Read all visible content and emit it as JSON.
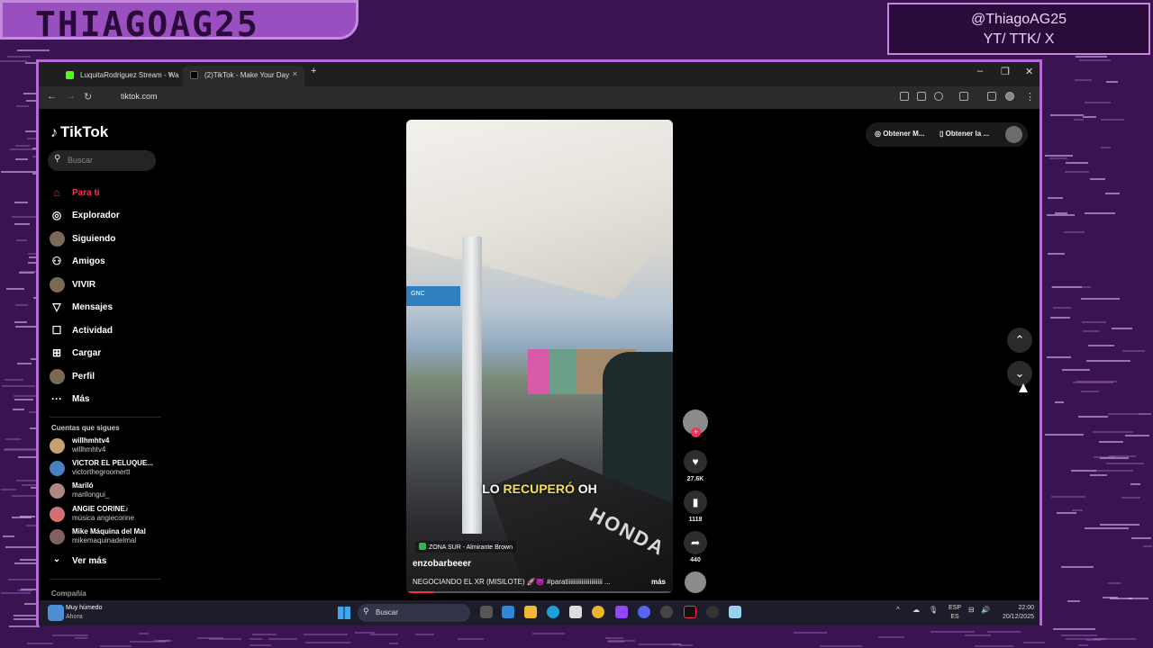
{
  "overlay": {
    "banner": "THIAGOAG25",
    "social_handle": "@ThiagoAG25",
    "social_platforms": "YT/ TTK/ X"
  },
  "browser": {
    "tabs": [
      {
        "label": "LuquitaRodriguez Stream - Wa",
        "close": "×",
        "favicon_color": "#53fc18"
      },
      {
        "label": "(2)TikTok - Make Your Day",
        "close": "×",
        "favicon_color": "#000000"
      }
    ],
    "new_tab": "+",
    "window_controls": {
      "minimize": "–",
      "restore": "❐",
      "close": "✕"
    },
    "nav": {
      "back": "←",
      "forward": "→",
      "reload": "↻"
    },
    "url": "tiktok.com"
  },
  "tiktok": {
    "logo": "TikTok",
    "logo_icon": "♪",
    "search_placeholder": "Buscar",
    "nav": [
      {
        "label": "Para ti",
        "icon": "home-icon",
        "glyph": "⌂",
        "active": true
      },
      {
        "label": "Explorador",
        "icon": "compass-icon",
        "glyph": "◎"
      },
      {
        "label": "Siguiendo",
        "icon": "following-avatar",
        "glyph": ""
      },
      {
        "label": "Amigos",
        "icon": "friends-icon",
        "glyph": "⚇"
      },
      {
        "label": "VIVIR",
        "icon": "live-avatar",
        "glyph": ""
      },
      {
        "label": "Mensajes",
        "icon": "send-icon",
        "glyph": "▽"
      },
      {
        "label": "Actividad",
        "icon": "inbox-icon",
        "glyph": "☐"
      },
      {
        "label": "Cargar",
        "icon": "upload-icon",
        "glyph": "⊞"
      },
      {
        "label": "Perfil",
        "icon": "profile-avatar",
        "glyph": ""
      },
      {
        "label": "Más",
        "icon": "more-icon",
        "glyph": "···"
      }
    ],
    "following_title": "Cuentas que sigues",
    "following": [
      {
        "name": "willhmhtv4",
        "handle": "willhmhtv4",
        "color": "#c9a070"
      },
      {
        "name": "VICTOR EL PELUQUE...",
        "handle": "victorthegroomertt",
        "color": "#4a7fc0"
      },
      {
        "name": "Mariló",
        "handle": "marilongui_",
        "color": "#b08880"
      },
      {
        "name": "ANGIE CORINE♪",
        "handle": "música angiecorine",
        "color": "#d07070"
      },
      {
        "name": "Mike Máquina del Mal",
        "handle": "mikemaquinadelmal",
        "color": "#806060"
      }
    ],
    "see_more": "Ver más",
    "see_more_icon": "⌄",
    "company": "Compañía",
    "top_buttons": [
      "Obtener M...",
      "Obtener la ..."
    ],
    "video": {
      "caption_plain_1": "LO ",
      "caption_highlight": "RECUPERÓ",
      "caption_plain_2": " OH",
      "sign_text": "GNC",
      "moto_brand": "HONDA",
      "location": "ZONA SUR - Almirante Brown",
      "author": "enzobarbeeer",
      "description": "NEGOCIANDO EL XR (MISILOTE) 🚀😈 #paratiiiiiiiiiiiiiiiiiiiiii ...",
      "more": "más",
      "progress": 0.1
    },
    "actions": {
      "plus": "+",
      "like_icon": "♥",
      "likes": "27.6K",
      "bookmark_icon": "▮",
      "saves": "1118",
      "share_icon": "➦",
      "shares": "440"
    },
    "scroll_up": "⌃",
    "scroll_down": "⌄"
  },
  "taskbar": {
    "weather_title": "Muy húmedo",
    "weather_sub": "Ahora",
    "search": "Buscar",
    "lang_top": "ESP",
    "lang_bottom": "ES",
    "time": "22:00",
    "date": "20/12/2025",
    "tray_icons": [
      "^",
      "☁",
      "🎙"
    ],
    "tray_right": [
      "⊟",
      "🔊"
    ]
  }
}
